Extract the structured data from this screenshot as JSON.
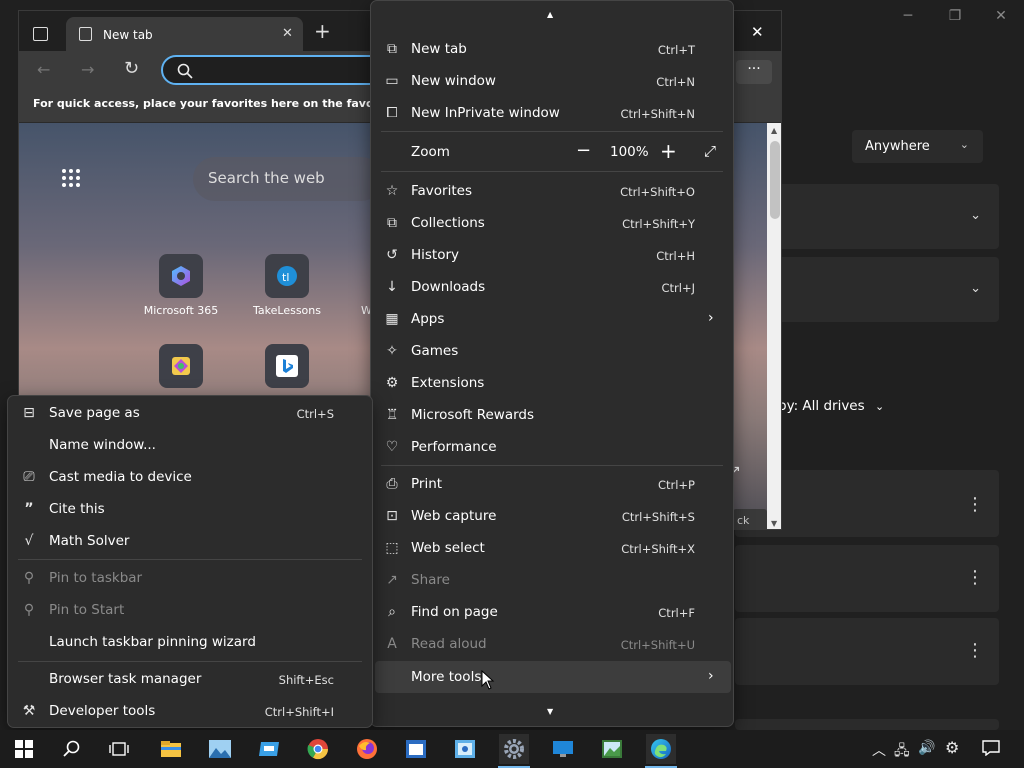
{
  "background_window": {
    "location_dropdown": "Anywhere",
    "sort_label": "by: All drives",
    "back_button": "ck"
  },
  "browser": {
    "tab_title": "New tab",
    "favorites_hint": "For quick access, place your favorites here on the favorites bar.",
    "search_placeholder": "Search the web",
    "tiles": [
      {
        "label": "Microsoft 365",
        "icon": "microsoft-365-icon"
      },
      {
        "label": "TakeLessons",
        "icon": "takelessons-icon"
      },
      {
        "label": "W",
        "icon": "generic-site-icon"
      }
    ]
  },
  "main_menu": {
    "items": [
      {
        "label": "New tab",
        "shortcut": "Ctrl+T",
        "icon": "new-tab-icon"
      },
      {
        "label": "New window",
        "shortcut": "Ctrl+N",
        "icon": "new-window-icon"
      },
      {
        "label": "New InPrivate window",
        "shortcut": "Ctrl+Shift+N",
        "icon": "inprivate-icon"
      },
      {
        "label": "Zoom",
        "zoom_value": "100%",
        "icon": "zoom-icon"
      },
      {
        "label": "Favorites",
        "shortcut": "Ctrl+Shift+O",
        "icon": "favorites-icon"
      },
      {
        "label": "Collections",
        "shortcut": "Ctrl+Shift+Y",
        "icon": "collections-icon"
      },
      {
        "label": "History",
        "shortcut": "Ctrl+H",
        "icon": "history-icon"
      },
      {
        "label": "Downloads",
        "shortcut": "Ctrl+J",
        "icon": "downloads-icon"
      },
      {
        "label": "Apps",
        "icon": "apps-icon"
      },
      {
        "label": "Games",
        "icon": "games-icon"
      },
      {
        "label": "Extensions",
        "icon": "extensions-icon"
      },
      {
        "label": "Microsoft Rewards",
        "icon": "rewards-icon"
      },
      {
        "label": "Performance",
        "icon": "performance-icon"
      },
      {
        "label": "Print",
        "shortcut": "Ctrl+P",
        "icon": "print-icon"
      },
      {
        "label": "Web capture",
        "shortcut": "Ctrl+Shift+S",
        "icon": "web-capture-icon"
      },
      {
        "label": "Web select",
        "shortcut": "Ctrl+Shift+X",
        "icon": "web-select-icon"
      },
      {
        "label": "Share",
        "icon": "share-icon",
        "disabled": true
      },
      {
        "label": "Find on page",
        "shortcut": "Ctrl+F",
        "icon": "find-icon"
      },
      {
        "label": "Read aloud",
        "shortcut": "Ctrl+Shift+U",
        "icon": "read-aloud-icon",
        "disabled": true
      },
      {
        "label": "More tools",
        "icon": "more-tools-icon",
        "highlighted": true
      }
    ]
  },
  "more_tools_menu": {
    "items": [
      {
        "label": "Save page as",
        "shortcut": "Ctrl+S",
        "icon": "save-icon"
      },
      {
        "label": "Name window...",
        "icon": ""
      },
      {
        "label": "Cast media to device",
        "icon": "cast-icon"
      },
      {
        "label": "Cite this",
        "icon": "quote-icon"
      },
      {
        "label": "Math Solver",
        "icon": "math-solver-icon"
      },
      {
        "label": "Pin to taskbar",
        "icon": "pin-icon",
        "disabled": true
      },
      {
        "label": "Pin to Start",
        "icon": "pin-icon",
        "disabled": true
      },
      {
        "label": "Launch taskbar pinning wizard",
        "icon": ""
      },
      {
        "label": "Browser task manager",
        "shortcut": "Shift+Esc",
        "icon": ""
      },
      {
        "label": "Developer tools",
        "shortcut": "Ctrl+Shift+I",
        "icon": "developer-tools-icon"
      }
    ]
  },
  "colors": {
    "menu_bg": "#2c2c2c",
    "accent": "#5fb2f2",
    "disabled_text": "#8a8a8a"
  }
}
